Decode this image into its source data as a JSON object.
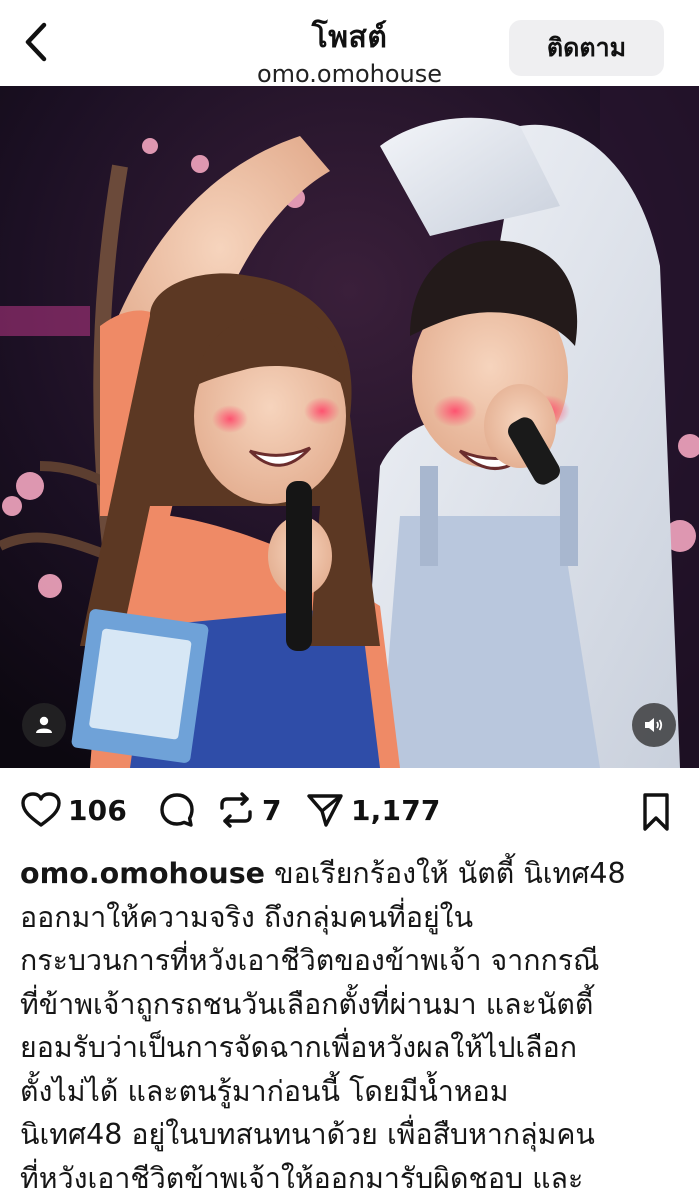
{
  "header": {
    "title": "โพสต์",
    "account": "omo.omohouse",
    "follow_label": "ติดตาม"
  },
  "post": {
    "likes": "106",
    "reposts": "7",
    "shares": "1,177"
  },
  "caption": {
    "username": "omo.omohouse",
    "lines": [
      "ขอเรียกร้องให้ นัตตี้ นิเทศ48",
      "ออกมาให้ความจริง ถึงกลุ่มคนที่อยู่ใน",
      "กระบวนการที่หวังเอาชีวิตของข้าพเจ้า จากกรณี",
      "ที่ข้าพเจ้าถูกรถชนวันเลือกตั้งที่ผ่านมา และนัตตี้",
      "ยอมรับว่าเป็นการจัดฉากเพื่อหวังผลให้ไปเลือก",
      "ตั้งไม่ได้ และตนรู้มาก่อนนี้ โดยมีน้ำหอม",
      "นิเทศ48 อยู่ในบทสนทนาด้วย เพื่อสืบหากลุ่มคน",
      "ที่หวังเอาชีวิตข้าพเจ้าให้ออกมารับผิดชอบ และ"
    ]
  },
  "icons": {
    "back": "chevron-left-icon",
    "like": "heart-icon",
    "comment": "comment-icon",
    "repost": "repost-icon",
    "share": "send-icon",
    "save": "bookmark-icon",
    "user_tag": "user-icon",
    "mute": "speaker-icon"
  }
}
